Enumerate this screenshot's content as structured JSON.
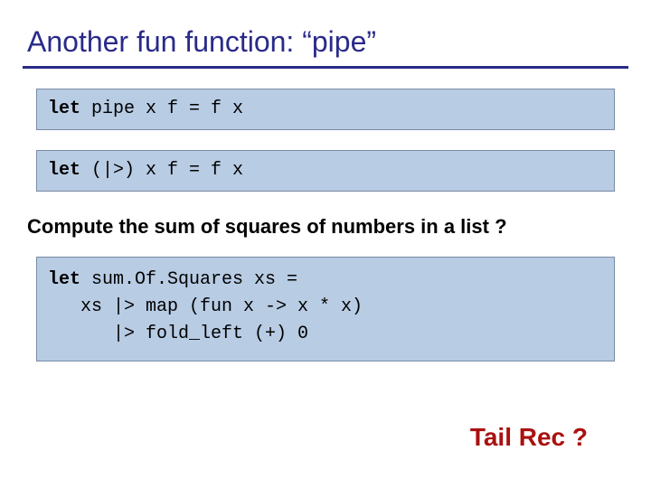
{
  "title": "Another fun function: “pipe”",
  "code1": {
    "kw": "let",
    "rest": " pipe x f = f x"
  },
  "code2": {
    "kw": "let",
    "rest": " (|>) x f = f x"
  },
  "subtitle": "Compute the sum of squares of numbers in a list ?",
  "code3": {
    "kw": "let",
    "line1_rest": " sum.Of.Squares xs =",
    "line2": "   xs |> map (fun x -> x * x)",
    "line3": "      |> fold_left (+) 0"
  },
  "tail": "Tail Rec  ?"
}
